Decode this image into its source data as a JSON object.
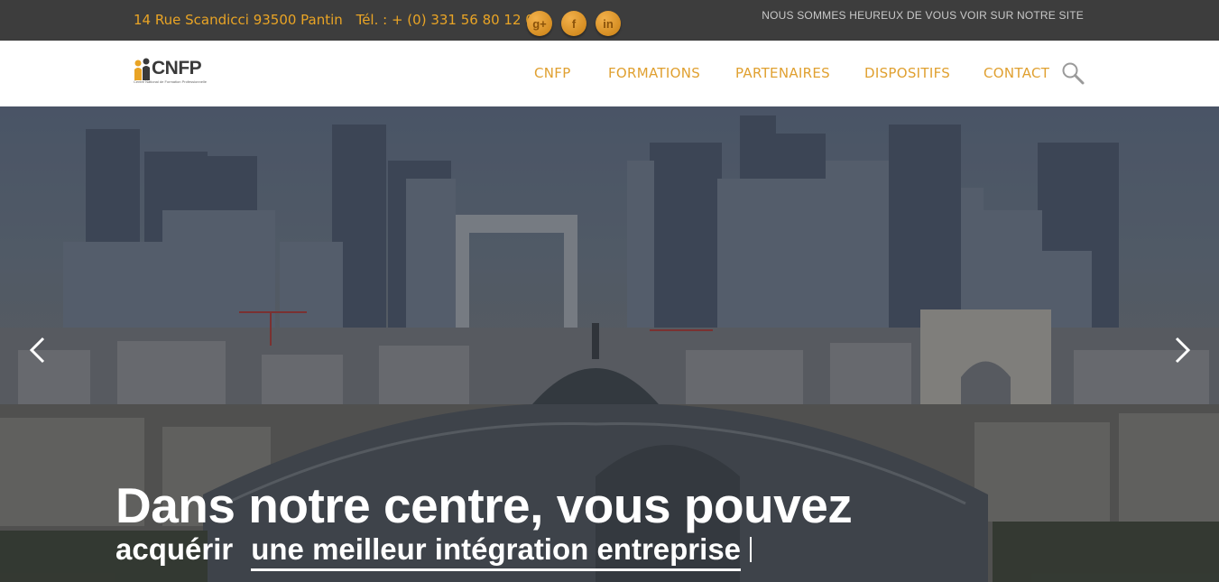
{
  "topbar": {
    "address": "14 Rue Scandicci 93500 Pantin",
    "phone": "Tél. : + (0) 331 56 80 12 00",
    "social": [
      {
        "icon": "google-plus-icon",
        "label": "g+"
      },
      {
        "icon": "facebook-icon",
        "label": "f"
      },
      {
        "icon": "linkedin-icon",
        "label": "in"
      }
    ],
    "welcome": "NOUS SOMMES HEUREUX DE VOUS VOIR SUR NOTRE SITE"
  },
  "logo": {
    "text": "CNFP",
    "subtitle": "Centre National de Formation Professionnelle"
  },
  "nav": {
    "items": [
      "CNFP",
      "FORMATIONS",
      "PARTENAIRES",
      "DISPOSITIFS",
      "CONTACT"
    ],
    "search_icon": "search-icon"
  },
  "hero": {
    "headline": "Dans notre centre, vous pouvez",
    "subline_prefix": "acquérir",
    "subline_highlight": "une meilleur intégration entreprise",
    "prev_icon": "chevron-left-icon",
    "next_icon": "chevron-right-icon"
  },
  "colors": {
    "accent": "#e0a030",
    "topbar_bg": "#3d3d3d"
  }
}
